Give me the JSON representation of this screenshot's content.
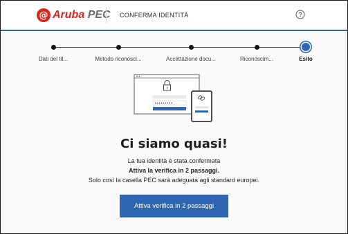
{
  "header": {
    "logo_mark": "@",
    "logo_brand": "Aruba",
    "logo_product": "PEC",
    "title": "CONFERMA IDENTITÀ",
    "help_icon": "question-circle-icon"
  },
  "stepper": {
    "steps": [
      {
        "label": "Dati del tit..."
      },
      {
        "label": "Metodo riconosci..."
      },
      {
        "label": "Accettazione docu..."
      },
      {
        "label": "Riconoscim..."
      },
      {
        "label": "Esito"
      }
    ],
    "current_step": "Esito"
  },
  "illustration": {
    "password_mask": "•••••••••",
    "icons": [
      "lock-icon",
      "link-icon"
    ]
  },
  "result": {
    "headline": "Ci siamo quasi!",
    "line1": "La tua identità è stata confermata",
    "line2": "Attiva la verifica in 2 passaggi.",
    "line3": "Solo così la casella PEC sarà adeguata agli standard europei."
  },
  "cta": {
    "label": "Attiva verifica in 2 passaggi"
  },
  "colors": {
    "accent": "#2f66b1",
    "brand": "#d9261c",
    "background": "#fafafa"
  }
}
